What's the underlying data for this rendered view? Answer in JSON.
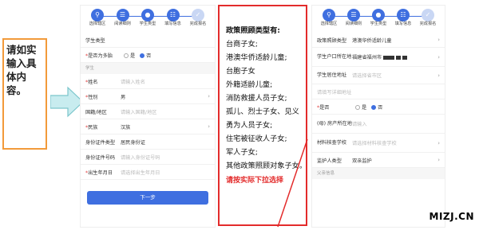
{
  "note": {
    "lines": [
      "请如实",
      "输入具",
      "体内容。"
    ]
  },
  "left_panel": {
    "steps": [
      {
        "label": "选择辖区"
      },
      {
        "label": "阅读细则"
      },
      {
        "label": "学生类型"
      },
      {
        "label": "填写信息"
      },
      {
        "label": "完成报名"
      }
    ],
    "student_type_label": "学生类型",
    "policy_child_label": "是否为多胎",
    "policy_options": [
      "是",
      "否"
    ],
    "section_student": "学生",
    "fields": [
      {
        "label": "姓名",
        "value": "请输入姓名",
        "placeholder": true,
        "required": true
      },
      {
        "label": "性别",
        "value": "男",
        "placeholder": false,
        "required": true
      },
      {
        "label": "国籍/地区",
        "value": "请输入国籍/地区",
        "placeholder": true,
        "required": false
      },
      {
        "label": "民族",
        "value": "汉族",
        "placeholder": false,
        "required": true
      },
      {
        "label": "身份证件类型",
        "value": "居民身份证",
        "placeholder": false,
        "required": false
      },
      {
        "label": "身份证件号码",
        "value": "请输入身份证号码",
        "placeholder": true,
        "required": false
      },
      {
        "label": "出生年月日",
        "value": "请选择出生年月日",
        "placeholder": true,
        "required": true
      }
    ],
    "next_button": "下一步"
  },
  "policy_box": {
    "title": "政策照顾类型有:",
    "items": [
      "台商子女;",
      "港澳华侨适龄儿童;",
      "台胞子女",
      "外籍适龄儿童;",
      "消防救援人员子女;",
      "孤儿、烈士子女、见义",
      "勇为人员子女;",
      "住宅被征收人子女;",
      "军人子女;",
      "其他政策照顾对象子女。"
    ],
    "hint": "请按实际下拉选择"
  },
  "right_panel": {
    "steps": [
      {
        "label": "选择辖区"
      },
      {
        "label": "阅读细则"
      },
      {
        "label": "学生类型"
      },
      {
        "label": "填写信息"
      },
      {
        "label": "完成报名"
      }
    ],
    "rows": [
      {
        "label": "政策照顾类型",
        "value": "港澳华侨适龄儿童",
        "placeholder": false
      },
      {
        "label": "学生户口所在地",
        "value": "福建省福州市",
        "placeholder": false
      },
      {
        "label": "学生居住地址",
        "value": "请选择省市区",
        "placeholder": true
      },
      {
        "label": "",
        "value": "请填写详细地址",
        "placeholder": true
      },
      {
        "label": "是否",
        "value": "是  否",
        "placeholder": false
      },
      {
        "label": "(母) 房产所在地",
        "value": "请输入",
        "placeholder": true
      },
      {
        "label": "材料核查学校",
        "value": "请选择材料核查学校",
        "placeholder": true
      },
      {
        "label": "监护人类型",
        "value": "双亲监护",
        "placeholder": false
      }
    ],
    "section_parent": "父亲信息"
  },
  "watermark": "MIZJ.CN",
  "colors": {
    "accent": "#3f6fe0",
    "policy_border": "#e32b2b",
    "note_border": "#f29a3a",
    "arrow": "#8fd3d8"
  }
}
